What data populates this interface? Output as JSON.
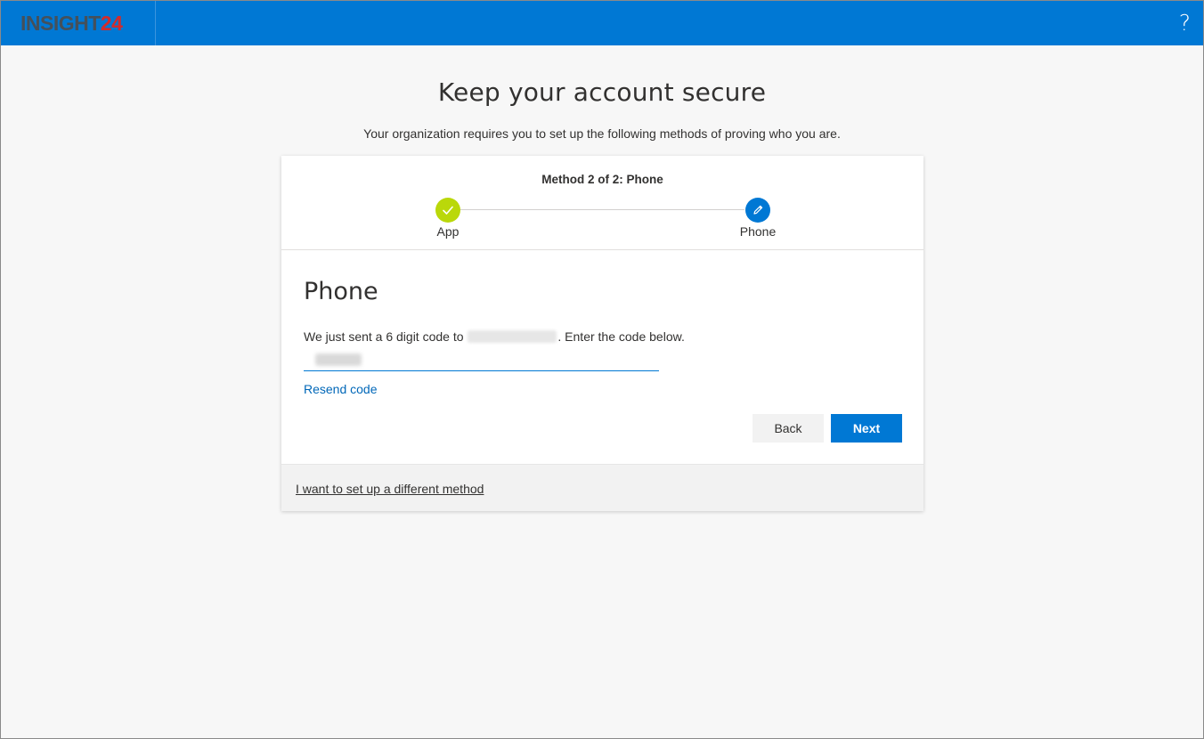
{
  "header": {
    "logo_part1": "INSIGHT",
    "logo_part2": "24",
    "help_label": "?",
    "brand_color": "#0078d4"
  },
  "page": {
    "title": "Keep your account secure",
    "subtitle": "Your organization requires you to set up the following methods of proving who you are."
  },
  "wizard": {
    "method_label": "Method 2 of 2: Phone",
    "steps": [
      {
        "label": "App",
        "state": "completed",
        "icon": "check-icon",
        "color": "#bad80a"
      },
      {
        "label": "Phone",
        "state": "current",
        "icon": "pencil-icon",
        "color": "#0078d4"
      }
    ]
  },
  "form": {
    "section_title": "Phone",
    "instruction_prefix": "We just sent a 6 digit code to",
    "instruction_suffix": ". Enter the code below.",
    "resend_label": "Resend code",
    "back_label": "Back",
    "next_label": "Next"
  },
  "footer": {
    "alt_method_label": "I want to set up a different method"
  }
}
